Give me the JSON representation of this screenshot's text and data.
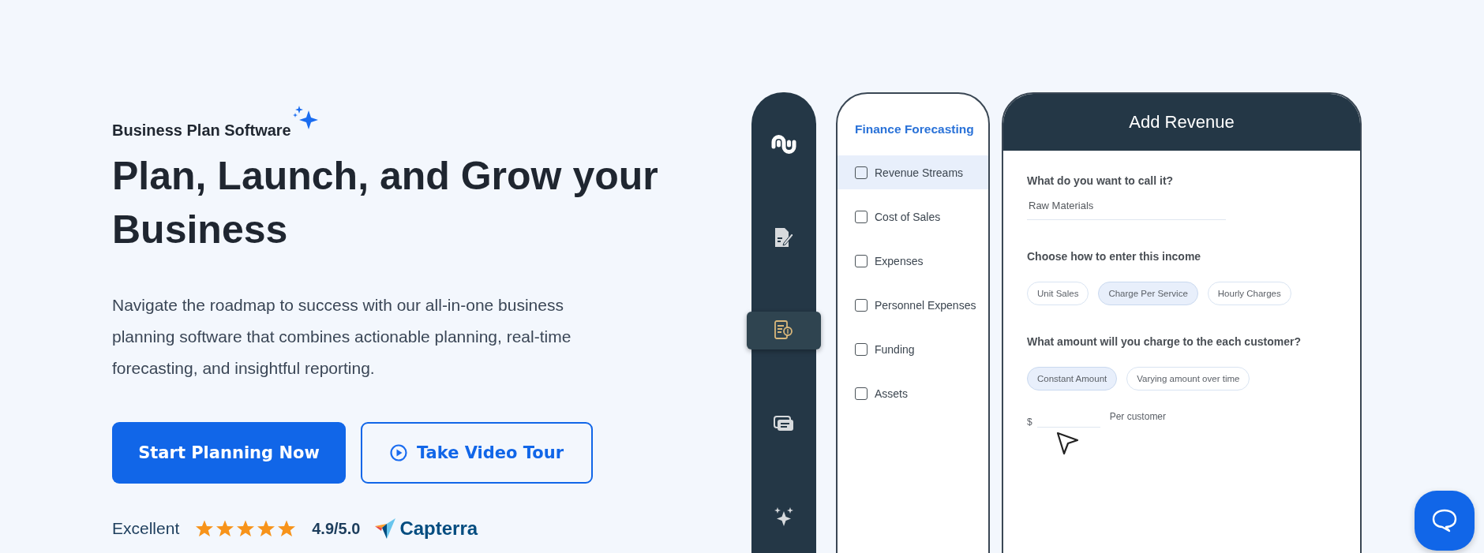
{
  "hero": {
    "eyebrow": "Business Plan Software",
    "headline": "Plan, Launch, and Grow your Business",
    "description": "Navigate the roadmap to success with our all-in-one business planning software that combines actionable planning, real-time forecasting, and insightful reporting.",
    "buttons": [
      {
        "kind": "primary",
        "label": "Start Planning Now"
      },
      {
        "kind": "video",
        "label": "Take Video Tour"
      }
    ],
    "rating": {
      "label": "Excellent",
      "stars": 5,
      "score": "4.9/5.0",
      "source": "Capterra"
    }
  },
  "app_preview": {
    "sidebar": [
      {
        "kind": "logo",
        "selected": false
      },
      {
        "kind": "document",
        "selected": false
      },
      {
        "kind": "finance",
        "selected": true
      },
      {
        "kind": "cards",
        "selected": false
      },
      {
        "kind": "sparkle",
        "selected": false
      }
    ],
    "checklist": {
      "title": "Finance Forecasting",
      "items": [
        {
          "label": "Revenue Streams",
          "checked": false,
          "selected": true
        },
        {
          "label": "Cost of Sales",
          "checked": false,
          "selected": false
        },
        {
          "label": "Expenses",
          "checked": false,
          "selected": false
        },
        {
          "label": "Personnel Expenses",
          "checked": false,
          "selected": false
        },
        {
          "label": "Funding",
          "checked": false,
          "selected": false
        },
        {
          "label": "Assets",
          "checked": false,
          "selected": false
        }
      ]
    },
    "form": {
      "title": "Add Revenue",
      "name_label": "What do you want to call it?",
      "name_value": "Raw Materials",
      "income_label": "Choose how to enter this income",
      "income_options": [
        {
          "label": "Unit Sales",
          "selected": false
        },
        {
          "label": "Charge Per Service",
          "selected": true
        },
        {
          "label": "Hourly Charges",
          "selected": false
        }
      ],
      "amount_label": "What amount will you charge to the each customer?",
      "amount_options": [
        {
          "label": "Constant Amount",
          "selected": true
        },
        {
          "label": "Varying amount over time",
          "selected": false
        }
      ],
      "currency": "$",
      "unit": "Per customer"
    }
  }
}
